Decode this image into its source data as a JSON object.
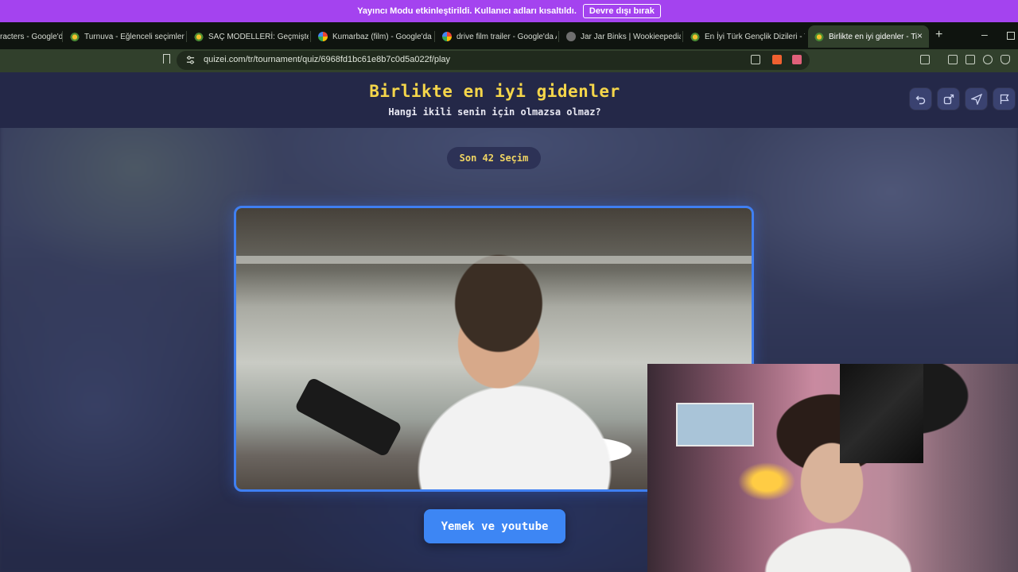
{
  "banner": {
    "message": "Yayıncı Modu etkinleştirildi. Kullanıcı adları kısaltıldı.",
    "button_label": "Devre dışı bırak"
  },
  "tabs": [
    {
      "label": "racters - Google'd",
      "icon": "google-icon"
    },
    {
      "label": "Turnuva - Eğlenceli seçimler y",
      "icon": "quiz-icon"
    },
    {
      "label": "SAÇ MODELLERİ: Geçmişten G",
      "icon": "quiz-icon"
    },
    {
      "label": "Kumarbaz (film) - Google'da A",
      "icon": "google-icon"
    },
    {
      "label": "drive film trailer - Google'da A",
      "icon": "google-icon"
    },
    {
      "label": "Jar Jar Binks | Wookieepedia | F",
      "icon": "wookieepedia-icon"
    },
    {
      "label": "En İyi Türk Gençlik Dizileri - T",
      "icon": "quiz-icon"
    },
    {
      "label": "Birlikte en iyi gidenler - Ti",
      "icon": "quiz-icon",
      "active": true
    }
  ],
  "browser": {
    "url": "quizei.com/tr/tournament/quiz/6968fd1bc61e8b7c0d5a022f/play",
    "new_tab": "+",
    "close_tab": "×",
    "minimize": "–"
  },
  "quiz": {
    "title": "Birlikte en iyi gidenler",
    "subtitle": "Hangi ikili senin için olmazsa olmaz?",
    "round_label": "Son 42 Seçim",
    "choice_label": "Yemek ve youtube",
    "header_icons": [
      "undo-icon",
      "share-icon",
      "send-icon",
      "flag-icon"
    ]
  },
  "colors": {
    "banner": "#a443ef",
    "title": "#f5d64a",
    "accent": "#3d86f4"
  }
}
